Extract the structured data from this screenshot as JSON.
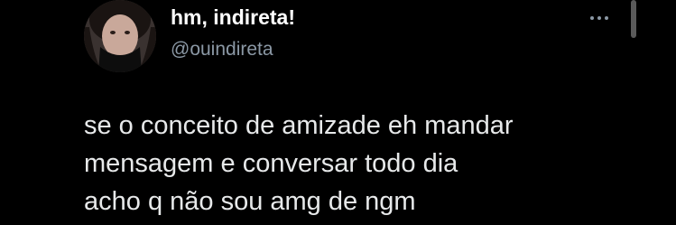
{
  "tweet": {
    "author": {
      "name": "hm, indireta!",
      "handle": "@ouindireta",
      "avatar_icon": "profile-photo"
    },
    "more_icon": "more-options-icon",
    "text_lines": [
      "se o conceito de amizade eh mandar",
      "mensagem e conversar todo dia",
      "acho q não sou amg de ngm"
    ]
  },
  "colors": {
    "background": "#000000",
    "name": "#ffffff",
    "handle": "#8b98a5",
    "body_text": "#e7e9ea"
  }
}
